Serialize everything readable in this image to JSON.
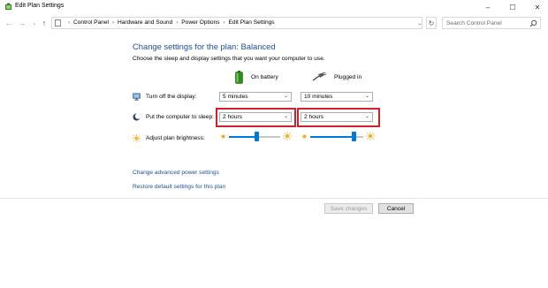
{
  "window": {
    "title": "Edit Plan Settings",
    "minimize": "–",
    "maximize": "☐",
    "close": "✕",
    "icon": "power-plan-icon"
  },
  "address": {
    "back": "←",
    "forward": "→",
    "recent": "⌄",
    "up": "↑",
    "breadcrumbs": [
      "Control Panel",
      "Hardware and Sound",
      "Power Options",
      "Edit Plan Settings"
    ],
    "separator": "›",
    "dropdown": "⌄",
    "refresh": "↻",
    "search_placeholder": "Search Control Panel"
  },
  "main": {
    "heading": "Change settings for the plan: Balanced",
    "subtitle": "Choose the sleep and display settings that you want your computer to use.",
    "columns": {
      "battery": "On battery",
      "plugged": "Plugged in"
    },
    "rows": {
      "display": {
        "label": "Turn off the display:",
        "battery": "5 minutes",
        "plugged": "10 minutes"
      },
      "sleep": {
        "label": "Put the computer to sleep:",
        "battery": "2 hours",
        "plugged": "2 hours"
      },
      "brightness": {
        "label": "Adjust plan brightness:",
        "battery_level": 0.55,
        "plugged_level": 0.82
      }
    },
    "links": {
      "advanced": "Change advanced power settings",
      "restore": "Restore default settings for this plan"
    },
    "buttons": {
      "save": "Save changes",
      "cancel": "Cancel"
    }
  },
  "colors": {
    "heading": "#1e4e9c",
    "link": "#1e4e9c",
    "highlight": "#d0202e",
    "slider": "#0078d7"
  }
}
